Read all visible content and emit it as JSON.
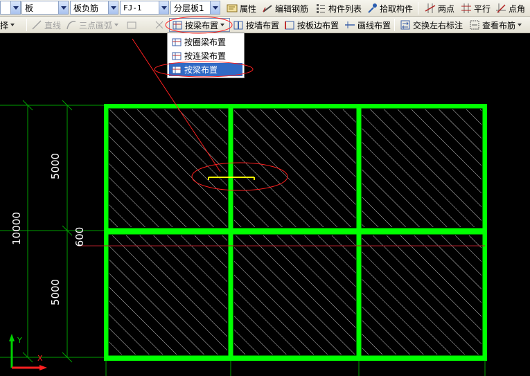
{
  "toolbar1": {
    "combo_type": "板",
    "combo_subtype": "板负筋",
    "combo_name": "FJ-1",
    "combo_layer": "分层板1",
    "properties_label": "属性",
    "edit_rebar_label": "编辑钢筋",
    "component_list_label": "构件列表",
    "pick_component_label": "拾取构件",
    "two_points_label": "两点",
    "parallel_label": "平行",
    "point_angle_label": "点角"
  },
  "toolbar2": {
    "select_label": "选择",
    "line_label": "直线",
    "three_point_arc_label": "三点画弧",
    "beam_place_label": "按梁布置",
    "wall_place_label": "按墙布置",
    "slab_edge_place_label": "按板边布置",
    "draw_line_place_label": "画线布置",
    "swap_lr_label": "交换左右标注",
    "view_rebar_label": "查看布筋"
  },
  "dropdown": {
    "items": [
      "按圈梁布置",
      "按连梁布置",
      "按梁布置"
    ],
    "selected_index": 2
  },
  "drawing": {
    "dim_top": "5000",
    "dim_bottom": "5000",
    "dim_total": "10000",
    "dim_offset": "600",
    "axis_y_label": "Y",
    "axis_x_label": "X"
  },
  "colors": {
    "beam": "#00ff00",
    "axis_line": "#00a000",
    "hatch": "#c8c8c8",
    "highlight_ellipse": "#ff2020",
    "rebar": "#ffff00",
    "menu_selected": "#316ac5"
  }
}
